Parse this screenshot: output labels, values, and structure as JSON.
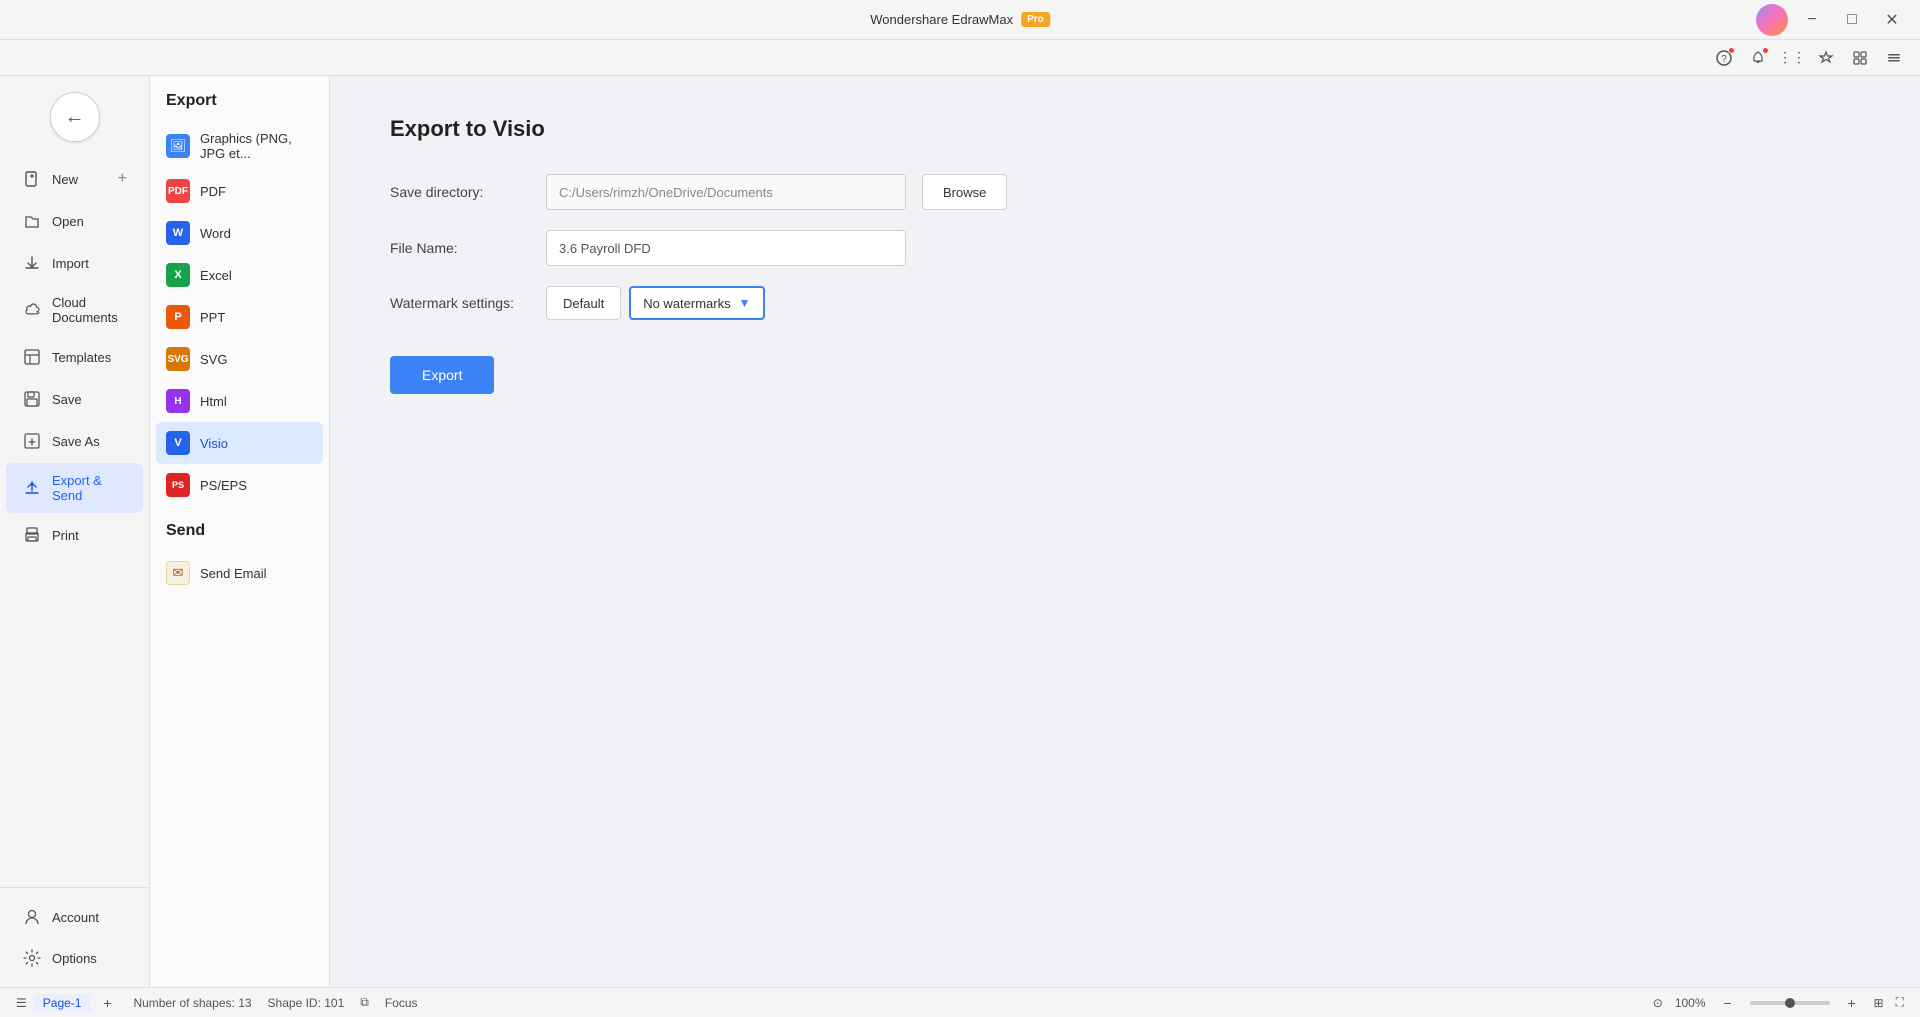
{
  "titleBar": {
    "appName": "Wondershare EdrawMax",
    "badge": "Pro",
    "toolbarIcons": [
      "help-icon",
      "notification-icon",
      "apps-icon",
      "theme-icon",
      "expand-icon"
    ]
  },
  "leftSidebar": {
    "navItems": [
      {
        "id": "new",
        "label": "New",
        "icon": "➕",
        "hasPlus": true
      },
      {
        "id": "open",
        "label": "Open",
        "icon": "📂"
      },
      {
        "id": "import",
        "label": "Import",
        "icon": "⬆"
      },
      {
        "id": "cloud",
        "label": "Cloud Documents",
        "icon": "☁"
      },
      {
        "id": "templates",
        "label": "Templates",
        "icon": "🗂"
      },
      {
        "id": "save",
        "label": "Save",
        "icon": "💾"
      },
      {
        "id": "saveas",
        "label": "Save As",
        "icon": "📋"
      },
      {
        "id": "exportSend",
        "label": "Export & Send",
        "icon": "📤",
        "active": true
      },
      {
        "id": "print",
        "label": "Print",
        "icon": "🖨"
      }
    ],
    "bottomItems": [
      {
        "id": "account",
        "label": "Account",
        "icon": "👤"
      },
      {
        "id": "options",
        "label": "Options",
        "icon": "⚙"
      }
    ]
  },
  "exportSidebar": {
    "title": "Export",
    "items": [
      {
        "id": "png",
        "label": "Graphics (PNG, JPG et...",
        "iconClass": "icon-png",
        "iconText": "🖼"
      },
      {
        "id": "pdf",
        "label": "PDF",
        "iconClass": "icon-pdf",
        "iconText": "📄"
      },
      {
        "id": "word",
        "label": "Word",
        "iconClass": "icon-word",
        "iconText": "W"
      },
      {
        "id": "excel",
        "label": "Excel",
        "iconClass": "icon-excel",
        "iconText": "X"
      },
      {
        "id": "ppt",
        "label": "PPT",
        "iconClass": "icon-ppt",
        "iconText": "P"
      },
      {
        "id": "svg",
        "label": "SVG",
        "iconClass": "icon-svg",
        "iconText": "S"
      },
      {
        "id": "html",
        "label": "Html",
        "iconClass": "icon-html",
        "iconText": "H"
      },
      {
        "id": "visio",
        "label": "Visio",
        "iconClass": "icon-visio",
        "iconText": "V",
        "active": true
      },
      {
        "id": "pseps",
        "label": "PS/EPS",
        "iconClass": "icon-pseps",
        "iconText": "PS"
      }
    ],
    "sendTitle": "Send",
    "sendItems": [
      {
        "id": "email",
        "label": "Send Email",
        "iconClass": "icon-email",
        "iconText": "✉"
      }
    ]
  },
  "mainContent": {
    "title": "Export to Visio",
    "form": {
      "directoryLabel": "Save directory:",
      "directoryValue": "C:/Users/rimzh/OneDrive/Documents",
      "directoryPlaceholder": "C:/Users/rimzh/OneDrive/Documents",
      "browseLabel": "Browse",
      "fileNameLabel": "File Name:",
      "fileNameValue": "3.6 Payroll DFD",
      "watermarkLabel": "Watermark settings:",
      "watermarkDefault": "Default",
      "watermarkOption": "No watermarks",
      "exportButton": "Export"
    }
  },
  "statusBar": {
    "numShapes": "Number of shapes: 13",
    "shapeId": "Shape ID: 101",
    "focusLabel": "Focus",
    "zoomLevel": "100%",
    "pageLabel": "Page-1",
    "pageTabLabel": "Page-1"
  }
}
